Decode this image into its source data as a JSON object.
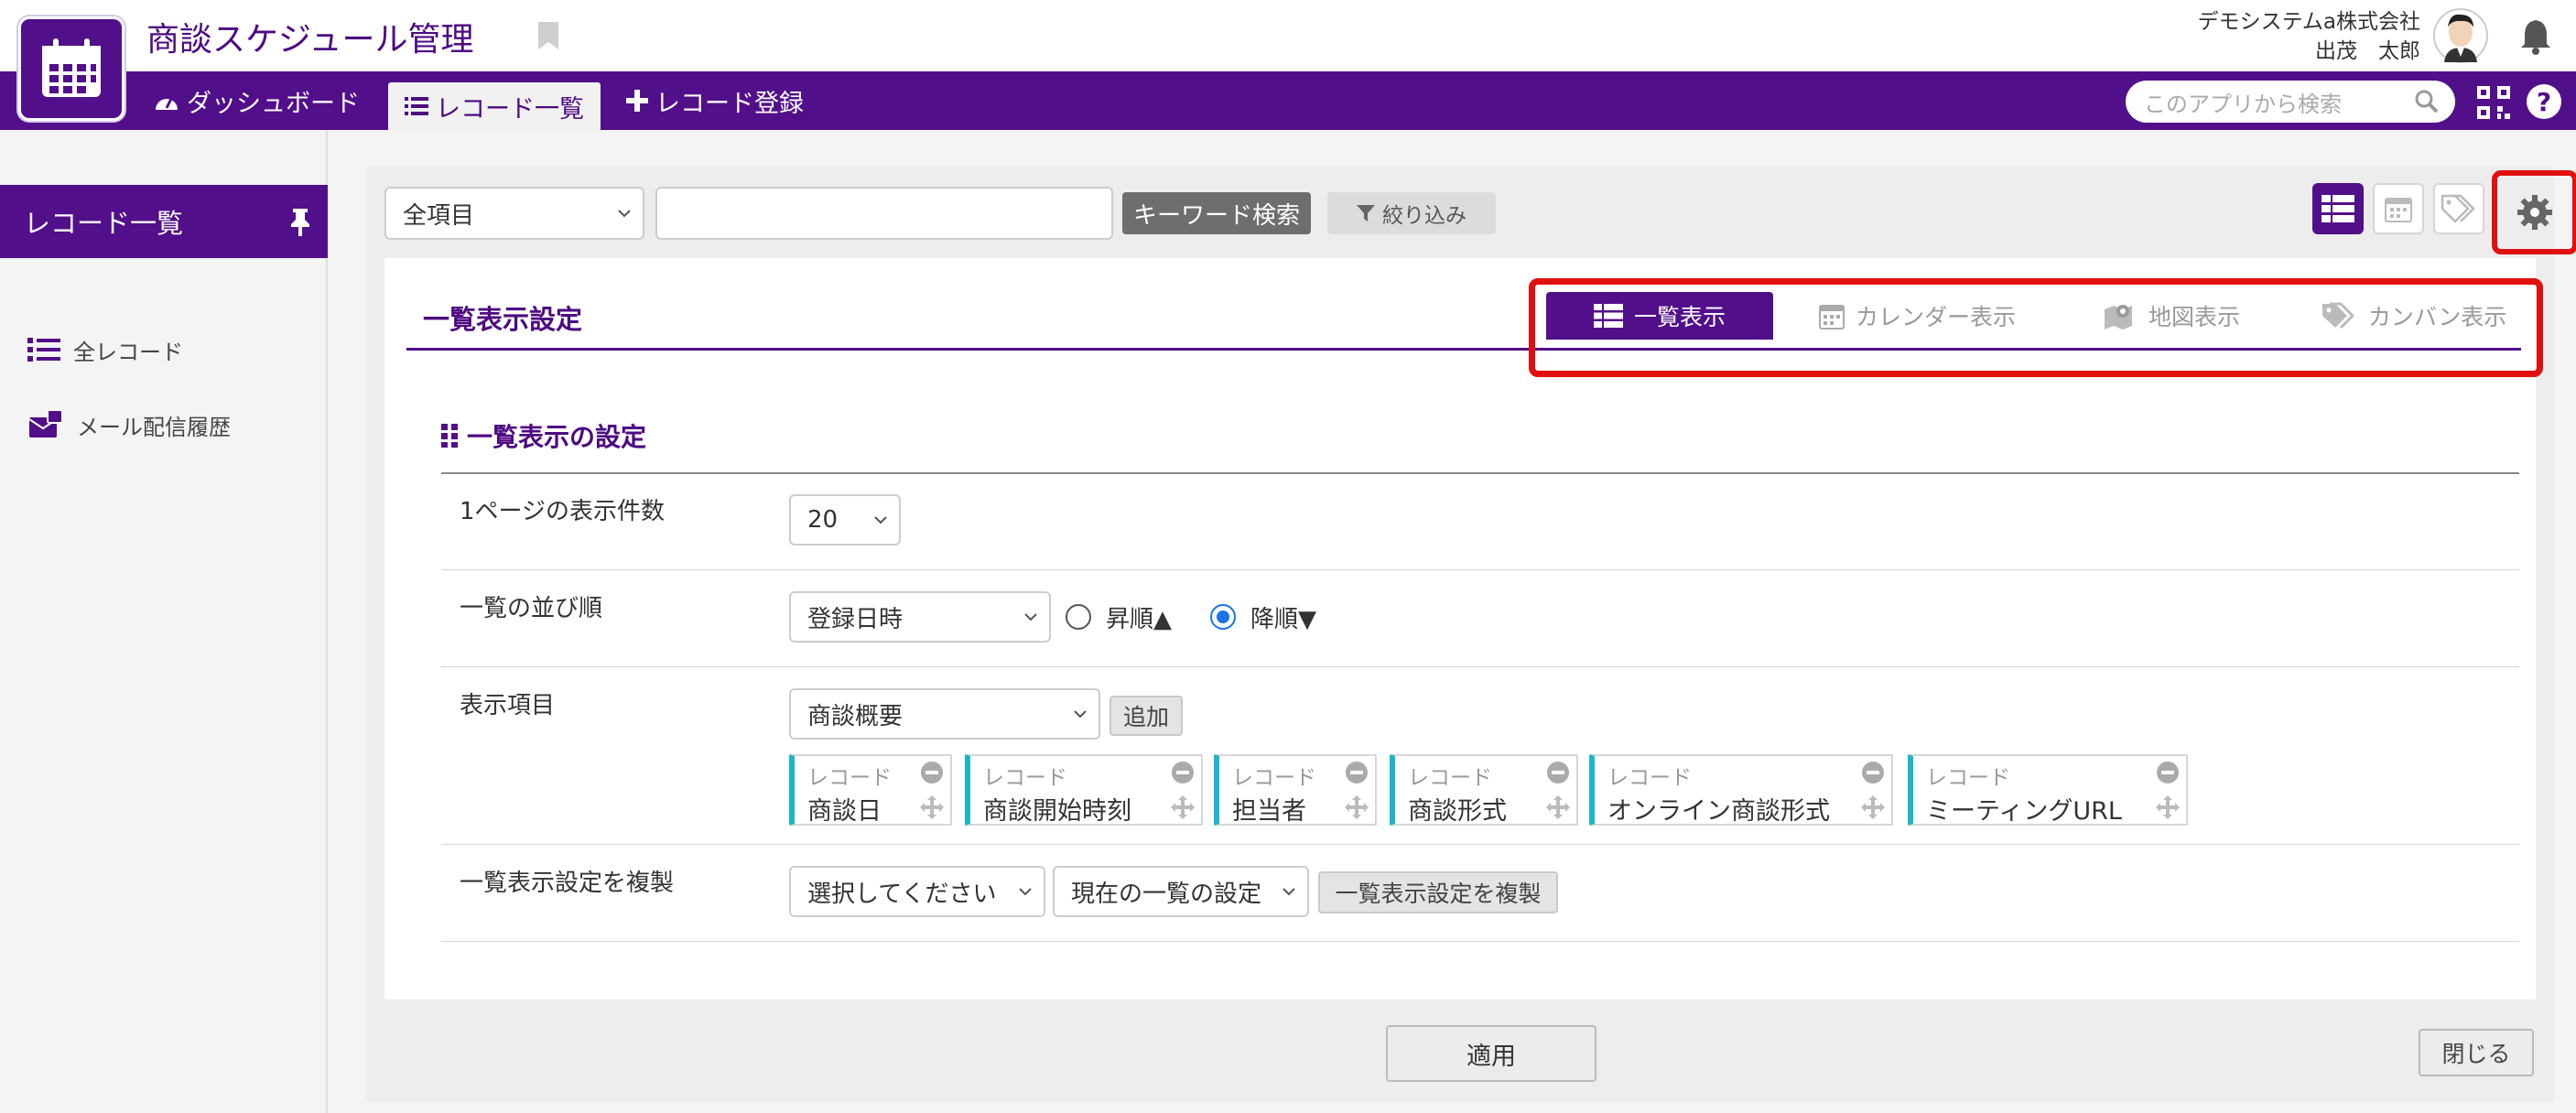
{
  "app": {
    "title": "商談スケジュール管理"
  },
  "user": {
    "company": "デモシステムa株式会社",
    "name": "出茂　太郎"
  },
  "nav": {
    "items": [
      {
        "label": "ダッシュボード",
        "icon": "dashboard-icon"
      },
      {
        "label": "レコード一覧",
        "icon": "list-icon",
        "active": true
      },
      {
        "label": "レコード登録",
        "icon": "plus-icon"
      }
    ],
    "search_placeholder": "このアプリから検索"
  },
  "sidebar": {
    "header": "レコード一覧",
    "items": [
      {
        "label": "全レコード",
        "icon": "list-icon"
      },
      {
        "label": "メール配信履歴",
        "icon": "mail-history-icon"
      }
    ]
  },
  "toolbar": {
    "field_select": "全項目",
    "keyword_value": "",
    "search_button": "キーワード検索",
    "filter_button": "絞り込み"
  },
  "settings": {
    "title": "一覧表示設定",
    "tabs": [
      {
        "label": "一覧表示",
        "icon": "table-icon",
        "active": true
      },
      {
        "label": "カレンダー表示",
        "icon": "calendar-icon"
      },
      {
        "label": "地図表示",
        "icon": "map-icon"
      },
      {
        "label": "カンバン表示",
        "icon": "tag-icon"
      }
    ],
    "section_title": "一覧表示の設定",
    "rows": {
      "per_page": {
        "label": "1ページの表示件数",
        "value": "20"
      },
      "sort": {
        "label": "一覧の並び順",
        "field": "登録日時",
        "asc_label": "昇順▲",
        "desc_label": "降順▼",
        "selected": "desc"
      },
      "fields": {
        "label": "表示項目",
        "select_value": "商談概要",
        "add_button": "追加",
        "chips": [
          {
            "sub": "レコード",
            "name": "商談日"
          },
          {
            "sub": "レコード",
            "name": "商談開始時刻"
          },
          {
            "sub": "レコード",
            "name": "担当者"
          },
          {
            "sub": "レコード",
            "name": "商談形式"
          },
          {
            "sub": "レコード",
            "name": "オンライン商談形式"
          },
          {
            "sub": "レコード",
            "name": "ミーティングURL"
          }
        ]
      },
      "copy": {
        "label": "一覧表示設定を複製",
        "select1": "選択してください",
        "select2": "現在の一覧の設定",
        "button": "一覧表示設定を複製"
      }
    },
    "apply_button": "適用",
    "close_button": "閉じる"
  },
  "colors": {
    "brand": "#520f8a",
    "highlight": "#e01010",
    "chip_accent": "#1cb5c8",
    "radio": "#1a73e8"
  }
}
